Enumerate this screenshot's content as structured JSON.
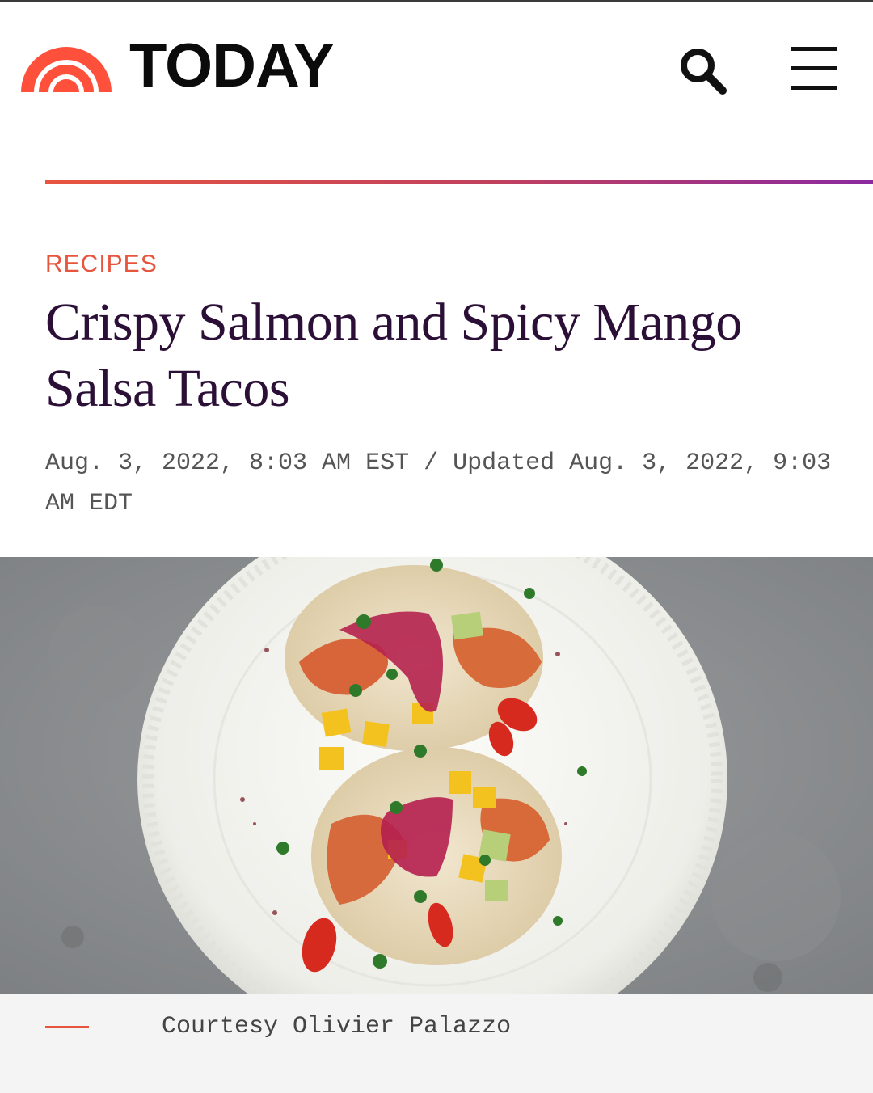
{
  "header": {
    "brand": "TODAY",
    "icons": {
      "logo": "today-sunrise-logo-icon",
      "search": "search-icon",
      "menu": "hamburger-menu-icon"
    },
    "logo_color": "#FF503C"
  },
  "article": {
    "kicker": "RECIPES",
    "title": "Crispy Salmon and Spicy Mango Salsa Tacos",
    "dateline": "Aug. 3, 2022, 8:03 AM EST / Updated Aug. 3, 2022, 9:03 AM EDT",
    "accent_color": "#E8553F",
    "title_color": "#2B0F37"
  },
  "hero_image": {
    "caption": "Courtesy Olivier Palazzo"
  }
}
